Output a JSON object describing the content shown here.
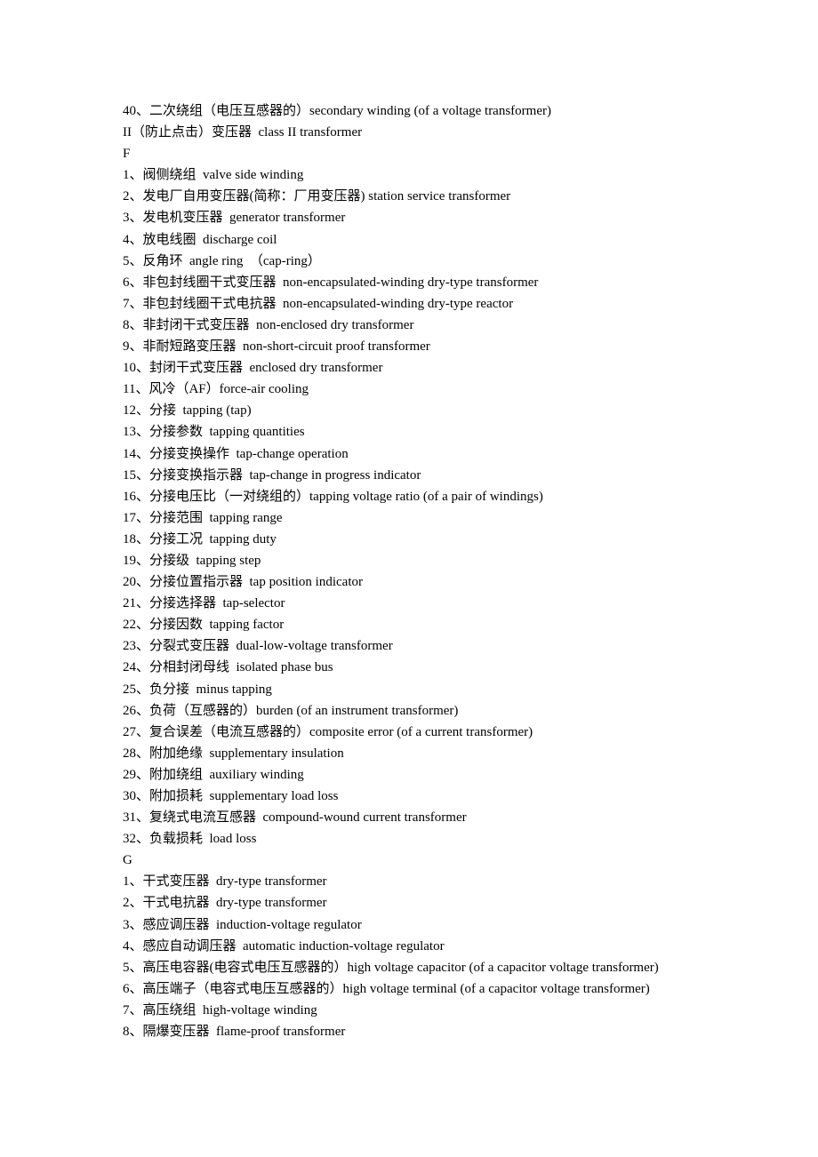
{
  "lines": [
    "40、二次绕组（电压互感器的）secondary winding (of a voltage transformer)",
    "II（防止点击）变压器  class II transformer",
    "F",
    "1、阀侧绕组  valve side winding",
    "2、发电厂自用变压器(简称：厂用变压器) station service transformer",
    "3、发电机变压器  generator transformer",
    "4、放电线圈  discharge coil",
    "5、反角环  angle ring  （cap-ring）",
    "6、非包封线圈干式变压器  non-encapsulated-winding dry-type transformer",
    "7、非包封线圈干式电抗器  non-encapsulated-winding dry-type reactor",
    "8、非封闭干式变压器  non-enclosed dry transformer",
    "9、非耐短路变压器  non-short-circuit proof transformer",
    "10、封闭干式变压器  enclosed dry transformer",
    "11、风冷（AF）force-air cooling",
    "12、分接  tapping (tap)",
    "13、分接参数  tapping quantities",
    "14、分接变换操作  tap-change operation",
    "15、分接变换指示器  tap-change in progress indicator",
    "16、分接电压比（一对绕组的）tapping voltage ratio (of a pair of windings)",
    "17、分接范围  tapping range",
    "18、分接工况  tapping duty",
    "19、分接级  tapping step",
    "20、分接位置指示器  tap position indicator",
    "21、分接选择器  tap-selector",
    "22、分接因数  tapping factor",
    "23、分裂式变压器  dual-low-voltage transformer",
    "24、分相封闭母线  isolated phase bus",
    "25、负分接  minus tapping",
    "26、负荷（互感器的）burden (of an instrument transformer)",
    "27、复合误差（电流互感器的）composite error (of a current transformer)",
    "28、附加绝缘  supplementary insulation",
    "29、附加绕组  auxiliary winding",
    "30、附加损耗  supplementary load loss",
    "31、复绕式电流互感器  compound-wound current transformer",
    "32、负载损耗  load loss",
    "G",
    "1、干式变压器  dry-type transformer",
    "2、干式电抗器  dry-type transformer",
    "3、感应调压器  induction-voltage regulator",
    "4、感应自动调压器  automatic induction-voltage regulator",
    "5、高压电容器(电容式电压互感器的）high voltage capacitor (of a capacitor voltage transformer)",
    "6、高压端子（电容式电压互感器的）high voltage terminal (of a capacitor voltage transformer)",
    "7、高压绕组  high-voltage winding",
    "8、隔爆变压器  flame-proof transformer"
  ]
}
